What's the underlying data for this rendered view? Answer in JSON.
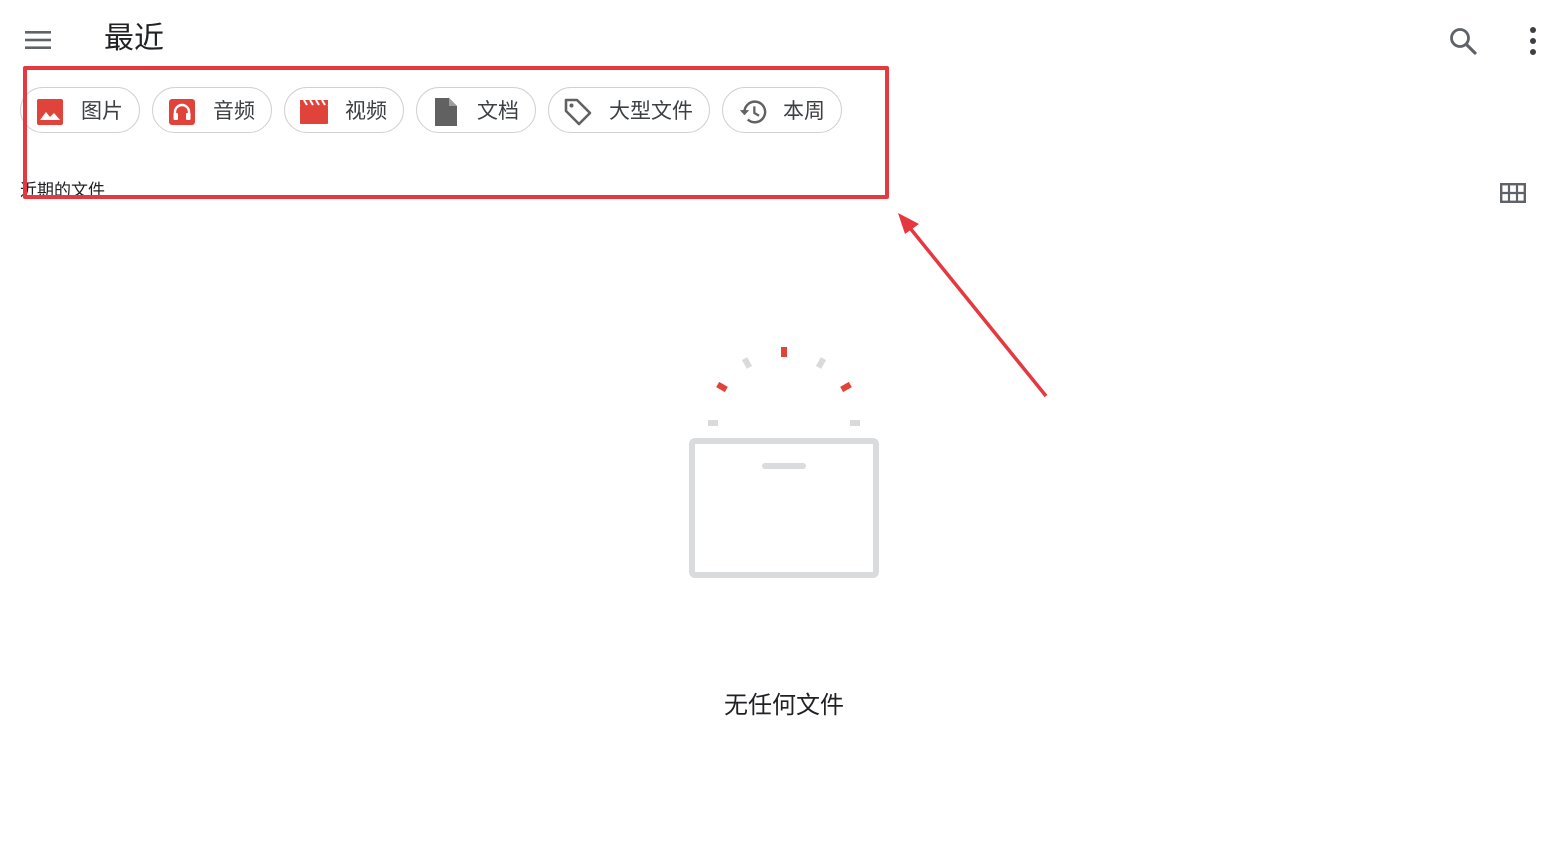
{
  "toolbar": {
    "title": "最近",
    "menu_icon": "menu-icon",
    "search_icon": "search-icon",
    "more_icon": "more-vert-icon"
  },
  "chips": [
    {
      "label": "图片",
      "icon": "image-icon",
      "color": "#e04339"
    },
    {
      "label": "音频",
      "icon": "headphones-icon",
      "color": "#e04339"
    },
    {
      "label": "视频",
      "icon": "movie-icon",
      "color": "#e04339"
    },
    {
      "label": "文档",
      "icon": "document-icon",
      "color": "#616161"
    },
    {
      "label": "大型文件",
      "icon": "tag-icon",
      "color": "#616161"
    },
    {
      "label": "本周",
      "icon": "history-icon",
      "color": "#616161"
    }
  ],
  "section": {
    "label": "近期的文件",
    "view_toggle_icon": "grid-view-icon"
  },
  "empty_state": {
    "message": "无任何文件"
  },
  "annotation": {
    "highlight_color": "#e5393f"
  }
}
